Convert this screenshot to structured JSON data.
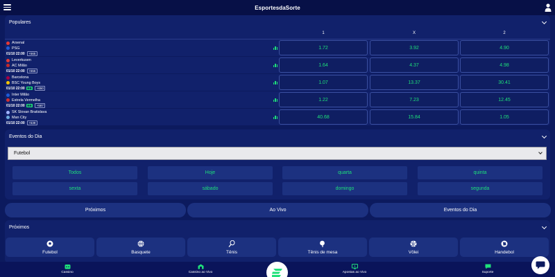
{
  "header": {
    "logo": "EsportesdaSorte"
  },
  "populares": {
    "title": "Populares",
    "col_labels": [
      "1",
      "X",
      "2"
    ],
    "matches": [
      {
        "home": "Arsenal",
        "away": "PSG",
        "home_color": "#e53935",
        "away_color": "#1e5bd8",
        "datetime": "01/10 22:00",
        "more": "+565",
        "live": "",
        "odds": [
          "1.72",
          "3.92",
          "4.90"
        ]
      },
      {
        "home": "Leverkusen",
        "away": "AC Milão",
        "home_color": "#e53935",
        "away_color": "#c62828",
        "datetime": "01/10 22:00",
        "more": "+556",
        "live": "",
        "odds": [
          "1.64",
          "4.37",
          "4.98"
        ]
      },
      {
        "home": "Barcelona",
        "away": "BSC Young Boys",
        "home_color": "#a50044",
        "away_color": "#f5c400",
        "datetime": "01/10 22:00",
        "more": "+650",
        "live": "BB",
        "odds": [
          "1.07",
          "13.37",
          "30.41"
        ]
      },
      {
        "home": "Inter Milão",
        "away": "Estrela Vermelha",
        "home_color": "#1e5bd8",
        "away_color": "#d32f2f",
        "datetime": "01/10 22:00",
        "more": "+587",
        "live": "BB",
        "odds": [
          "1.22",
          "7.23",
          "12.45"
        ]
      },
      {
        "home": "SK Slovan Bratislava",
        "away": "Man City",
        "home_color": "#9fb3ff",
        "away_color": "#6cabdd",
        "datetime": "01/10 22:00",
        "more": "+538",
        "live": "",
        "odds": [
          "40.68",
          "15.84",
          "1.05"
        ]
      }
    ]
  },
  "eventos": {
    "title": "Eventos do Dia",
    "select_value": "Futebol",
    "days": [
      "Todos",
      "Hoje",
      "quarta",
      "quinta",
      "sexta",
      "sábado",
      "domingo",
      "segunda"
    ]
  },
  "pills": [
    "Próximos",
    "Ao Vivo",
    "Eventos do Dia"
  ],
  "proximos": {
    "title": "Próximos",
    "sports": [
      {
        "label": "Futebol",
        "icon": "soccer-ball-icon"
      },
      {
        "label": "Basquete",
        "icon": "basketball-icon"
      },
      {
        "label": "Tênis",
        "icon": "tennis-racket-icon"
      },
      {
        "label": "Tênis de mesa",
        "icon": "table-tennis-icon"
      },
      {
        "label": "Vôlei",
        "icon": "volleyball-icon"
      },
      {
        "label": "Handebol",
        "icon": "handball-icon"
      }
    ]
  },
  "bottom_nav": [
    {
      "label": "Cassino",
      "icon": "dice-icon"
    },
    {
      "label": "Cassino ao Vivo",
      "icon": "casino-live-icon"
    },
    {
      "label": "Apostas ao Vivo",
      "icon": "monitor-icon"
    },
    {
      "label": "Suporte",
      "icon": "chat-icon"
    }
  ],
  "colors": {
    "background": "#0c1a5e",
    "panel": "#11216b",
    "accent": "#1ee17a"
  }
}
